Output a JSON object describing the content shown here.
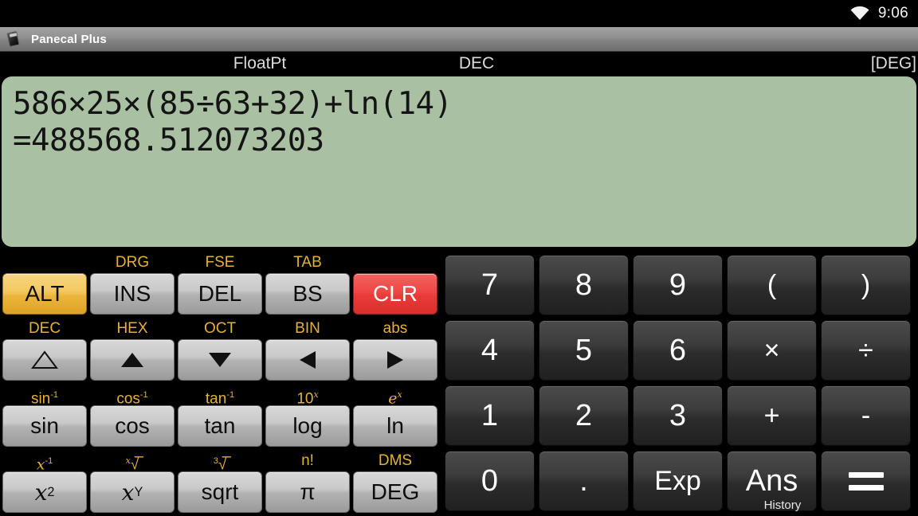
{
  "statusbar": {
    "wifi_icon": "wifi-icon",
    "time": "9:06"
  },
  "titlebar": {
    "icon": "calculator-app-icon",
    "title": "Panecal Plus"
  },
  "modes": {
    "notation": "FloatPt",
    "base": "DEC",
    "angle": "[DEG]"
  },
  "display": {
    "expression": "586×25×(85÷63+32)+ln(14)",
    "result": "=488568.512073203"
  },
  "function_keys": {
    "rows": [
      {
        "shift": [
          "",
          "DRG",
          "FSE",
          "TAB",
          ""
        ],
        "keys": [
          "ALT",
          "INS",
          "DEL",
          "BS",
          "CLR"
        ],
        "styles": [
          "alt",
          "",
          "",
          "",
          "clr"
        ]
      },
      {
        "shift": [
          "DEC",
          "HEX",
          "OCT",
          "BIN",
          "abs"
        ],
        "keys": [
          "triangle-up-outline",
          "triangle-up",
          "triangle-down",
          "triangle-left",
          "triangle-right"
        ],
        "styles": [
          "icon",
          "icon",
          "icon",
          "icon",
          "icon"
        ]
      },
      {
        "shift": [
          "sin-1",
          "cos-1",
          "tan-1",
          "10x",
          "ex"
        ],
        "keys": [
          "sin",
          "cos",
          "tan",
          "log",
          "ln"
        ],
        "styles": [
          "",
          "",
          "",
          "",
          ""
        ]
      },
      {
        "shift": [
          "x-1",
          "x-root",
          "cube-root",
          "n!",
          "DMS"
        ],
        "keys": [
          "x2",
          "xY",
          "sqrt",
          "π",
          "DEG"
        ],
        "styles": [
          "",
          "",
          "",
          "",
          ""
        ]
      }
    ]
  },
  "numpad": {
    "rows": [
      [
        "7",
        "8",
        "9",
        "(",
        ")"
      ],
      [
        "4",
        "5",
        "6",
        "×",
        "÷"
      ],
      [
        "1",
        "2",
        "3",
        "+",
        "-"
      ],
      [
        "0",
        ".",
        "Exp",
        "Ans",
        "="
      ]
    ],
    "ans_sublabel": "History"
  },
  "colors": {
    "display_bg": "#a9c0a3",
    "shift_label": "#e3b23c",
    "alt_key": "#f2c85f",
    "clear_key": "#ef4744",
    "gray_key": "#c9c9c9",
    "dark_key": "#3c3c3c",
    "titlebar": "#909090"
  }
}
